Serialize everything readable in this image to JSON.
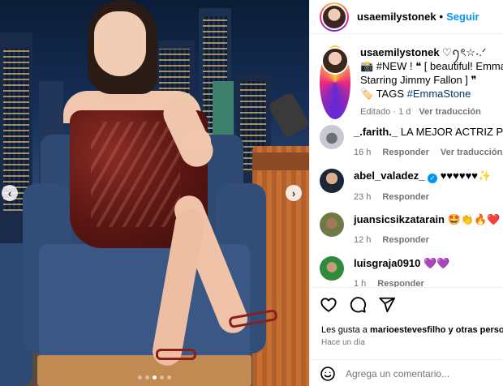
{
  "header": {
    "username": "usaemilystonek",
    "separator": "•",
    "follow_label": "Seguir"
  },
  "caption": {
    "username": "usaemilystonek",
    "badge": "♡ꪆৎ☆˖.ᐟ",
    "line1": "📸 #NEW ! ❝ [ beautiful! Emma Stone",
    "line2": "Starring Jimmy Fallon ] ❞",
    "tags_label": "🏷️ TAGS",
    "tag": "#EmmaStone",
    "edited": "Editado",
    "age": "1 d",
    "see_translation": "Ver traducción"
  },
  "comments": [
    {
      "username": "_.farith._",
      "text": "LA MEJOR ACTRIZ PORNO",
      "age": "16 h",
      "reply": "Responder",
      "translate": "Ver traducción",
      "verified": false
    },
    {
      "username": "abel_valadez_",
      "text": "♥♥♥♥♥♥✨",
      "age": "23 h",
      "reply": "Responder",
      "translate": "",
      "verified": true
    },
    {
      "username": "juansicsikzatarain",
      "text": "🤩👏🔥❤️",
      "age": "12 h",
      "reply": "Responder",
      "translate": "",
      "verified": false
    },
    {
      "username": "luisgraja0910",
      "text": "💜💜",
      "age": "1 h",
      "reply": "Responder",
      "translate": "",
      "verified": false
    }
  ],
  "likes": {
    "prefix": "Les gusta a",
    "user": "marioestevesfilho",
    "suffix": "y otras personas"
  },
  "posted": "Hace un día",
  "add_comment": {
    "placeholder": "Agrega un comentario..."
  },
  "carousel": {
    "prev_icon": "‹",
    "next_icon": "›",
    "slides": 5,
    "active_slide": 3
  },
  "colors": {
    "follow_blue": "#0095f6",
    "muted_gray": "#737373"
  }
}
